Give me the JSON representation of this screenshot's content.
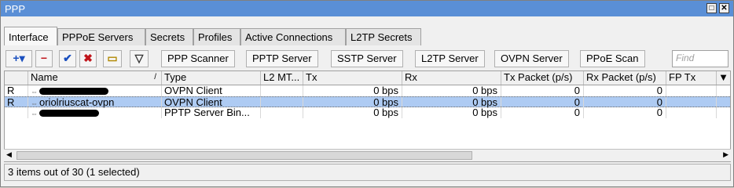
{
  "window": {
    "title": "PPP",
    "restore_glyph": "□",
    "close_glyph": "✕"
  },
  "tabs": [
    "Interface",
    "PPPoE Servers",
    "Secrets",
    "Profiles",
    "Active Connections",
    "L2TP Secrets"
  ],
  "toolbar": {
    "add_glyph": "+▾",
    "remove_glyph": "−",
    "enable_glyph": "✔",
    "disable_glyph": "✖",
    "comment_glyph": "▭",
    "filter_glyph": "▽",
    "buttons": [
      "PPP Scanner",
      "PPTP Server",
      "SSTP Server",
      "L2TP Server",
      "OVPN Server",
      "PPoE Scan"
    ],
    "find_placeholder": "Find"
  },
  "table": {
    "columns": [
      "Name",
      "Type",
      "L2 MT...",
      "Tx",
      "Rx",
      "Tx Packet (p/s)",
      "Rx Packet (p/s)",
      "FP Tx"
    ],
    "sort_indicator": "/",
    "rows": [
      {
        "flag": "R",
        "name": "",
        "type": "OVPN Client",
        "l2mtu": "",
        "tx": "0 bps",
        "rx": "0 bps",
        "txp": "0",
        "rxp": "0",
        "fptx": ""
      },
      {
        "flag": "R",
        "name": "oriolriuscat-ovpn",
        "type": "OVPN Client",
        "l2mtu": "",
        "tx": "0 bps",
        "rx": "0 bps",
        "txp": "0",
        "rxp": "0",
        "fptx": "",
        "selected": true
      },
      {
        "flag": "",
        "name": "",
        "type": "PPTP Server Bin...",
        "l2mtu": "",
        "tx": "0 bps",
        "rx": "0 bps",
        "txp": "0",
        "rxp": "0",
        "fptx": ""
      }
    ]
  },
  "status": "3 items out of 30 (1 selected)",
  "colors": {
    "titlebar": "#5a8fd6",
    "selected_row": "#aecbf3",
    "add_icon": "#1a4fbf",
    "remove_icon": "#c0151b",
    "enable_icon": "#1a4fbf",
    "disable_icon": "#c0151b"
  }
}
